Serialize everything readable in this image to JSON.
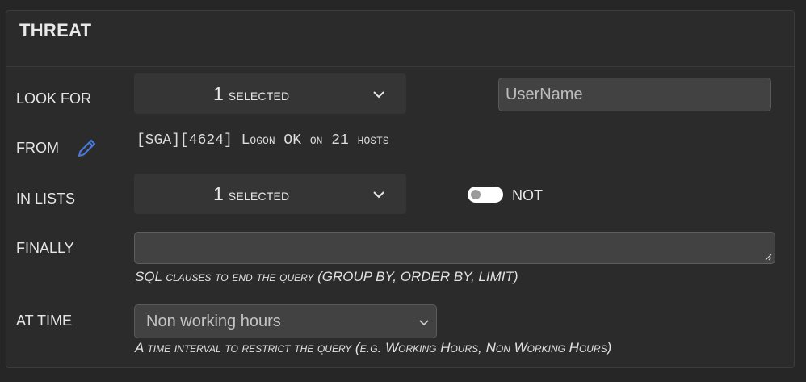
{
  "panel": {
    "title": "THREAT"
  },
  "look_for": {
    "label": "LOOK FOR",
    "dropdown_count": "1",
    "dropdown_word": "SELECTED",
    "field_placeholder": "UserName"
  },
  "from": {
    "label": "FROM",
    "source_text": "[SGA][4624] Logon OK on 21 hosts"
  },
  "in_lists": {
    "label": "IN LISTS",
    "dropdown_count": "1",
    "dropdown_word": "SELECTED",
    "not_toggle_on": false,
    "not_label": "NOT"
  },
  "finally": {
    "label": "FINALLY",
    "value": "",
    "hint": "SQL clauses to end the query (GROUP BY, ORDER BY, LIMIT)"
  },
  "at_time": {
    "label": "AT TIME",
    "selected": "Non working hours",
    "hint": "A time interval to restrict the query (e.g. Working Hours, Non Working Hours)"
  },
  "colors": {
    "background": "#262626",
    "panel": "#2b2b2b",
    "input": "#424242",
    "dropdown": "#353535",
    "accent_icon": "#4a78d8"
  },
  "icons": {
    "edit": "pencil-icon",
    "dropdown": "chevron-down-icon",
    "select": "chevron-down-icon",
    "resize": "resize-grip-icon"
  }
}
